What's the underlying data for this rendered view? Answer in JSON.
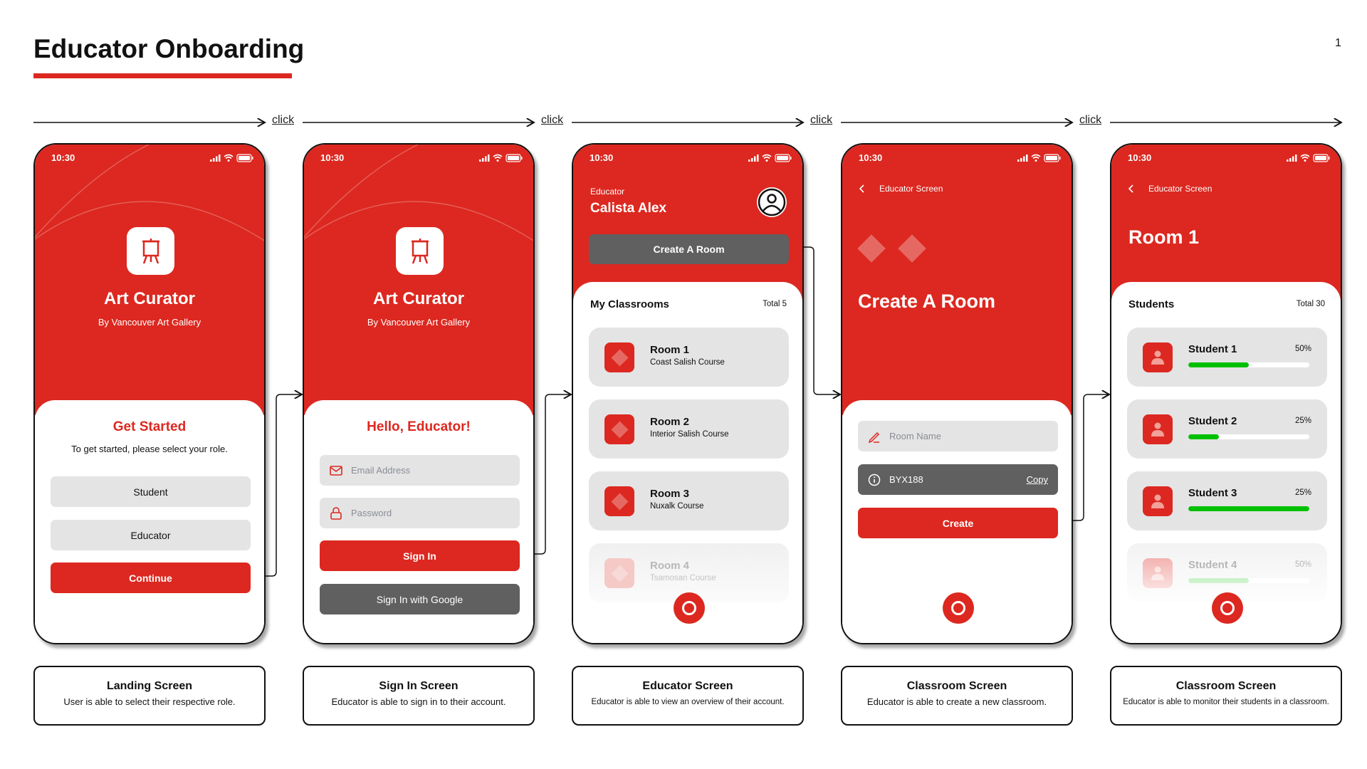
{
  "header": {
    "title": "Educator Onboarding",
    "page_number": "1"
  },
  "flow": {
    "click_labels": [
      "click",
      "click",
      "click",
      "click"
    ]
  },
  "status": {
    "time": "10:30"
  },
  "colors": {
    "brand_red": "#dc2820",
    "dark_gray": "#606060",
    "light_gray": "#e4e4e4",
    "progress_green": "#00c000"
  },
  "landing": {
    "app_name": "Art Curator",
    "app_sub": "By Vancouver Art Gallery",
    "heading": "Get Started",
    "instructions": "To get started, please select your role.",
    "student_button": "Student",
    "educator_button": "Educator",
    "continue_button": "Continue"
  },
  "signin": {
    "app_name": "Art Curator",
    "app_sub": "By Vancouver Art Gallery",
    "heading": "Hello, Educator!",
    "email_placeholder": "Email Address",
    "password_placeholder": "Password",
    "signin_button": "Sign In",
    "google_button": "Sign In with Google"
  },
  "educator": {
    "role": "Educator",
    "name": "Calista Alex",
    "create_button": "Create A Room",
    "section_title": "My Classrooms",
    "total": "Total 5",
    "rooms": [
      {
        "name": "Room 1",
        "course": "Coast Salish Course"
      },
      {
        "name": "Room 2",
        "course": "Interior Salish Course"
      },
      {
        "name": "Room 3",
        "course": "Nuxalk Course"
      },
      {
        "name": "Room 4",
        "course": "Tsamosan Course"
      }
    ]
  },
  "create_room": {
    "back_label": "Educator Screen",
    "title": "Create A Room",
    "room_name_placeholder": "Room Name",
    "code": "BYX188",
    "copy_label": "Copy",
    "create_button": "Create"
  },
  "room": {
    "back_label": "Educator Screen",
    "title": "Room 1",
    "section_title": "Students",
    "total": "Total 30",
    "students": [
      {
        "name": "Student 1",
        "percent_label": "50%",
        "progress": 0.5
      },
      {
        "name": "Student 2",
        "percent_label": "25%",
        "progress": 0.25
      },
      {
        "name": "Student 3",
        "percent_label": "25%",
        "progress": 1.0
      },
      {
        "name": "Student 4",
        "percent_label": "50%",
        "progress": 0.5
      }
    ]
  },
  "captions": [
    {
      "title": "Landing Screen",
      "desc": "User is able to select their respective role."
    },
    {
      "title": "Sign In Screen",
      "desc": "Educator is able to sign in to their account."
    },
    {
      "title": "Educator Screen",
      "desc": "Educator is able to view an overview of their account."
    },
    {
      "title": "Classroom Screen",
      "desc": "Educator is able to create a new classroom."
    },
    {
      "title": "Classroom Screen",
      "desc": "Educator is able to monitor their students in a classroom."
    }
  ]
}
